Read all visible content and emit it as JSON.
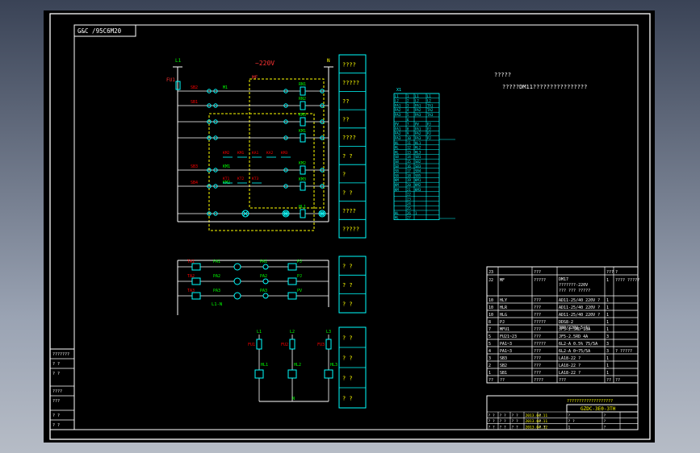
{
  "drawing": {
    "title_tab": "G&C /95C6M20",
    "voltage_label": "~220V",
    "power_left": "L1",
    "power_right": "N",
    "main_breaker": "MF",
    "top_fuse": "FU1",
    "note_line1": "?????",
    "note_line2": "?????DM11????????????????",
    "control_rows": [
      {
        "left": "SB2",
        "left2": "M1",
        "right": "RN1"
      },
      {
        "left": "SB1",
        "left2": "",
        "right": "RN2"
      },
      {
        "left": "",
        "left2": "",
        "right": "KM3"
      },
      {
        "left": "",
        "left2": "",
        "right": "KM1"
      },
      {
        "left": "SB3",
        "left2": "KM1",
        "right": "KM2"
      },
      {
        "left": "SB4",
        "left2": "KM2",
        "right": "KM3"
      },
      {
        "left": "",
        "left2": "",
        "right": "HL1"
      }
    ],
    "contact_labels": [
      "KM2",
      "KM1",
      "KA1",
      "KA2",
      "KM3",
      "KT1",
      "KT2",
      "KT3"
    ],
    "meter_rows": [
      {
        "a": "TA1",
        "b": "PA1",
        "c": "PA1",
        "d": "PJ"
      },
      {
        "a": "TA2",
        "b": "PA2",
        "c": "PA2",
        "d": "PJ"
      },
      {
        "a": "TA3",
        "b": "PA3",
        "c": "PA3",
        "d": "PV"
      }
    ],
    "meter_bottom_label": "L1-N",
    "fuse_cols": [
      {
        "top": "L1",
        "fuse": "FU1",
        "lamp": "HL1"
      },
      {
        "top": "L2",
        "fuse": "FU2",
        "lamp": "HL2"
      },
      {
        "top": "L3",
        "fuse": "FU3",
        "lamp": "HL3"
      }
    ],
    "fuse_bottom_label": "N",
    "side_boxes_a": [
      "????",
      "?????",
      "??",
      "??",
      "????",
      "? ?",
      "?",
      "? ?",
      "????",
      "?????"
    ],
    "side_boxes_b": [
      "? ?",
      "? ?",
      "? ?"
    ],
    "side_boxes_c": [
      "? ?",
      "? ?",
      "? ?",
      "? ?"
    ],
    "terminal_header": "X1",
    "terminal_rows": [
      [
        "L1",
        "1",
        "L1",
        "L1"
      ],
      [
        "L2",
        "2",
        "L2",
        "L2"
      ],
      [
        "PA1",
        "3",
        "PA1",
        "TA1"
      ],
      [
        "PA2",
        "4",
        "PA2",
        "TA2"
      ],
      [
        "PA3",
        "5",
        "PA3",
        "TA3"
      ],
      [
        "",
        "6",
        "",
        ""
      ],
      [
        "PV",
        "7",
        "PV",
        "PJ"
      ],
      [
        "PA1",
        "8",
        "PA1",
        "PJ"
      ],
      [
        "PA2",
        "9",
        "PA2",
        "PJ"
      ],
      [
        "PA3",
        "10",
        "PA3",
        "PJ"
      ],
      [
        "HL",
        "11",
        "HL1",
        ""
      ],
      [
        "HL",
        "12",
        "HL2",
        ""
      ],
      [
        "HL",
        "13",
        "HL3",
        ""
      ],
      [
        "SB",
        "14",
        "SB1",
        ""
      ],
      [
        "SB",
        "15",
        "SB2",
        ""
      ],
      [
        "SB",
        "16",
        "SB3",
        ""
      ],
      [
        "SB",
        "17",
        "SB4",
        ""
      ],
      [
        "SB",
        "18",
        "SB5",
        ""
      ],
      [
        "KM",
        "19",
        "KM1",
        ""
      ],
      [
        "KM",
        "20",
        "KM2",
        ""
      ],
      [
        "KM",
        "21",
        "KM3",
        ""
      ],
      [
        "",
        "22",
        "",
        ""
      ],
      [
        "",
        "23",
        "",
        ""
      ],
      [
        "",
        "24",
        "",
        ""
      ],
      [
        "",
        "25",
        "",
        ""
      ],
      [
        "HL",
        "26",
        "1",
        ""
      ],
      [
        "HL",
        "27",
        "",
        ""
      ]
    ],
    "bom_header": [
      "J3",
      "",
      "???",
      "",
      "???",
      "?"
    ],
    "bom_rows": [
      [
        "J2",
        "MF",
        "?????",
        "DM17 ???????-220V ??? ??? ?????",
        "1",
        "???? ?????"
      ],
      [
        "10",
        "HLY",
        "???",
        "AD11-25/40 220V ?",
        "1",
        ""
      ],
      [
        "10",
        "HLR",
        "???",
        "AD11-25/40 220V ?",
        "1",
        ""
      ],
      [
        "10",
        "HLG",
        "???",
        "AD11-25/40 220V ?",
        "1",
        ""
      ],
      [
        "8",
        "PJ",
        "?????",
        "DDS8-2 380/220V 5(6)",
        "1",
        ""
      ],
      [
        "7",
        "MFU1",
        "???",
        "JF5-2.5RD 10A",
        "1",
        ""
      ],
      [
        "5",
        "FU21~23",
        "???",
        "JF5-2.5RD 4A",
        "3",
        ""
      ],
      [
        "5",
        "PA1~3",
        "?????",
        "6L2-A 0.5% 75/5A",
        "3",
        ""
      ],
      [
        "4",
        "PA1~3",
        "???",
        "6L2-A 0~75/5A",
        "3",
        "? ?????"
      ],
      [
        "3",
        "SB3",
        "???",
        "LA18-22 ?",
        "1",
        ""
      ],
      [
        "2",
        "SB2",
        "???",
        "LA18-22 ?",
        "1",
        ""
      ],
      [
        "1",
        "SB1",
        "???",
        "LA18-22 ?",
        "1",
        ""
      ],
      [
        "??",
        "??",
        "????",
        "???",
        "??",
        "??"
      ]
    ],
    "title_block_top": "???????????????????",
    "title_block_code": "GZDC-3E0-3TH",
    "title_rows": [
      [
        "? ?",
        "? ?",
        "? ?",
        "2013.04.11",
        "?",
        "?",
        "?"
      ],
      [
        "? ?",
        "? ?",
        "? ?",
        "2013.04.11",
        "?",
        "? ?",
        "?"
      ],
      [
        "? ?",
        "? ?",
        "? ?",
        "2013.04.12",
        "? ?",
        "1",
        "?"
      ]
    ],
    "left_strip": [
      "???????",
      "? ?",
      "? ?",
      "????",
      "???",
      "? ?",
      "? ?"
    ]
  },
  "colors": {
    "frame": "#ffffff",
    "wire": "#ffffff",
    "cyan": "#00ffff",
    "red": "#ff0000",
    "green": "#00ff00",
    "yellow": "#ffff00",
    "magenta": "#ff00ff"
  }
}
